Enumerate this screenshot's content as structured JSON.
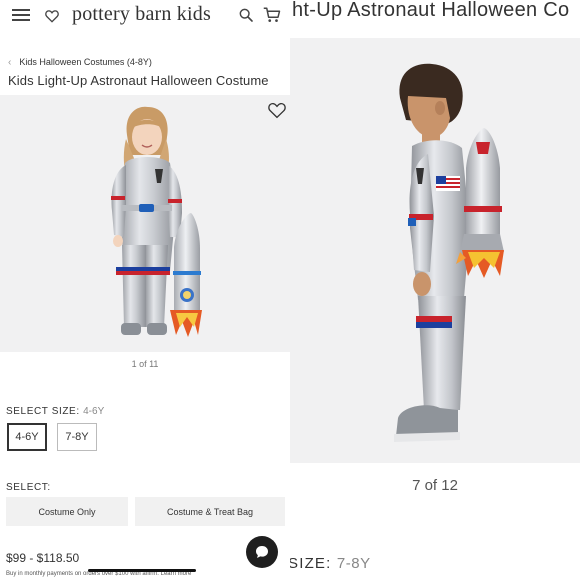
{
  "left": {
    "brand": "pottery barn kids",
    "breadcrumb": "Kids Halloween Costumes (4-8Y)",
    "title": "Kids Light-Up Astronaut Halloween Costume",
    "image_counter": "1 of 11",
    "select_size_label": "SELECT SIZE:",
    "select_size_value": "4-6Y",
    "sizes": [
      "4-6Y",
      "7-8Y"
    ],
    "select_label": "SELECT:",
    "options": [
      "Costume Only",
      "Costume & Treat Bag"
    ],
    "price": "$99 - $118.50",
    "affirm_text": "Buy in monthly payments on orders over $100 with affirm. Learn more"
  },
  "right": {
    "title": "ht-Up Astronaut Halloween Co",
    "image_counter": "7 of 12",
    "size_label": "SIZE:",
    "size_value": "7-8Y"
  },
  "icons": {
    "menu": "hamburger-icon",
    "favorite": "heart-icon",
    "search": "search-icon",
    "cart": "cart-icon",
    "chat": "chat-icon",
    "breadcrumb": "chevron-left-icon"
  },
  "colors": {
    "text": "#333333",
    "photo_bg": "#f1f1f2",
    "option_bg": "#f1f1f1",
    "chat_bg": "#1f1f1f"
  }
}
